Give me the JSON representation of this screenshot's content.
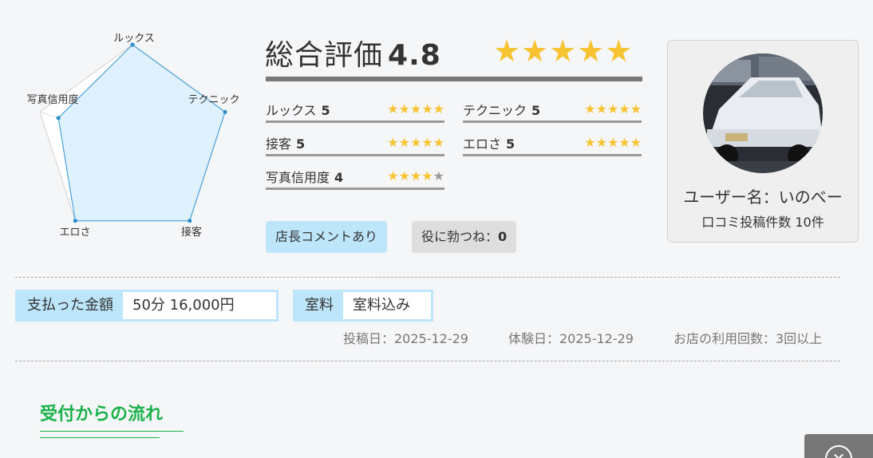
{
  "radar": {
    "labels": [
      "ルックス",
      "テクニック",
      "接客",
      "エロさ",
      "写真信用度"
    ],
    "values": [
      5,
      5,
      5,
      5,
      4
    ],
    "max": 5
  },
  "overall": {
    "label": "総合評価",
    "score": "4.8",
    "stars": "★★★★★",
    "rating": 4.8
  },
  "categories": [
    {
      "name": "ルックス",
      "score": "5",
      "stars_on": "★★★★★",
      "stars_off": ""
    },
    {
      "name": "テクニック",
      "score": "5",
      "stars_on": "★★★★★",
      "stars_off": ""
    },
    {
      "name": "接客",
      "score": "5",
      "stars_on": "★★★★★",
      "stars_off": ""
    },
    {
      "name": "エロさ",
      "score": "5",
      "stars_on": "★★★★★",
      "stars_off": ""
    },
    {
      "name": "写真信用度",
      "score": "4",
      "stars_on": "★★★★",
      "stars_off": "★"
    }
  ],
  "badges": {
    "comment": "店長コメントあり",
    "helpful_label": "役に勃つね：",
    "helpful_count": "0"
  },
  "profile": {
    "username": "ユーザー名：いのべー",
    "review_count": "口コミ投稿件数 10件"
  },
  "payment": {
    "amount_label": "支払った金額",
    "amount_value": "50分 16,000円",
    "room_label": "室料",
    "room_value": "室料込み"
  },
  "meta": {
    "posted": "投稿日：2025-12-29",
    "visited": "体験日：2025-12-29",
    "visits": "お店の利用回数：3回以上"
  },
  "section": {
    "flow_title": "受付からの流れ"
  },
  "colors": {
    "star": "#f7c331",
    "accent_blue": "#bde6fb",
    "radar_fill": "#dff1fc",
    "radar_stroke": "#4aa3d6",
    "section_green": "#1bb14a"
  }
}
